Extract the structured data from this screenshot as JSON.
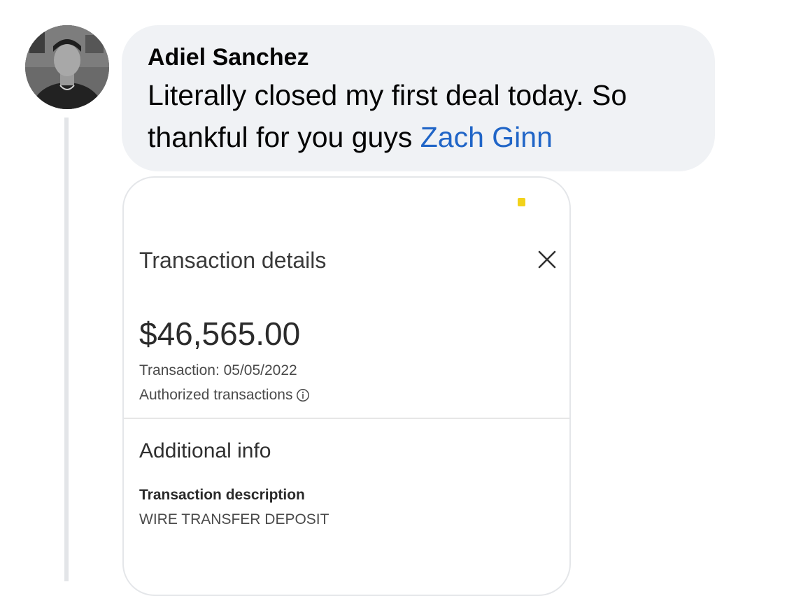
{
  "comment": {
    "author": "Adiel Sanchez",
    "text": "Literally closed my first deal today. So thankful for you guys",
    "mention": "Zach Ginn"
  },
  "transaction_card": {
    "title": "Transaction details",
    "amount": "$46,565.00",
    "date_text": "Transaction: 05/05/2022",
    "status_text": "Authorized transactions",
    "section_title": "Additional info",
    "description_label": "Transaction description",
    "description_value": "WIRE TRANSFER DEPOSIT",
    "icons": {
      "close": "close-icon",
      "info": "info-icon"
    }
  },
  "colors": {
    "bubble_background": "#f0f2f5",
    "mention_link": "#2065c7",
    "status_dot": "#f2d21b"
  }
}
